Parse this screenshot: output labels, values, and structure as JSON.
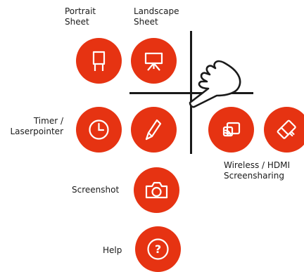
{
  "colors": {
    "accent": "#e63312",
    "icon": "#ffffff",
    "text": "#1a1a1a"
  },
  "labels": {
    "portrait": [
      "Portrait",
      "Sheet"
    ],
    "landscape": [
      "Landscape",
      "Sheet"
    ],
    "timer": [
      "Timer /",
      "Laserpointer"
    ],
    "wireless": [
      "Wireless / HDMI",
      "Screensharing"
    ],
    "screenshot": "Screenshot",
    "help": "Help"
  },
  "icons": {
    "portrait": "portrait-sheet-icon",
    "landscape": "landscape-sheet-icon",
    "timer": "clock-icon",
    "pen": "pen-icon",
    "cast": "cast-icon",
    "eraser": "eraser-icon",
    "screenshot": "camera-icon",
    "help": "help-icon",
    "hand": "pointing-hand-icon"
  },
  "help_glyph": "?"
}
